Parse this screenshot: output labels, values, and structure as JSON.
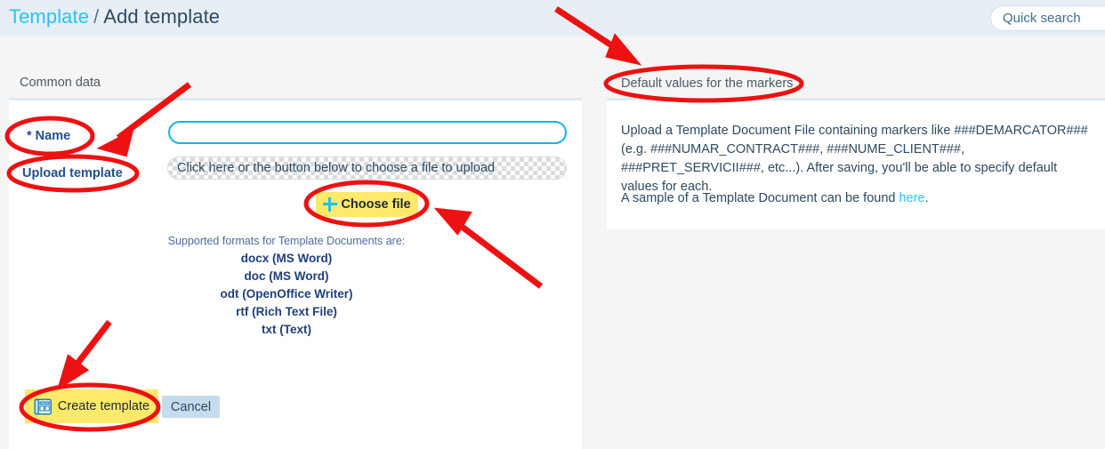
{
  "header": {
    "breadcrumb_root": "Template",
    "breadcrumb_separator": "/",
    "breadcrumb_current": "Add template",
    "quick_search_placeholder": "Quick search",
    "quick_search_value": ""
  },
  "left_panel": {
    "section_title": "Common data",
    "name_label": "* Name",
    "name_value": "",
    "name_placeholder": "",
    "upload_label": "Upload template",
    "dropzone_text": "Click here or the button below to choose a file to upload",
    "choose_file_label": "Choose file",
    "formats_heading": "Supported formats for Template Documents are:",
    "formats": [
      "docx (MS Word)",
      "doc (MS Word)",
      "odt (OpenOffice Writer)",
      "rtf (Rich Text File)",
      "txt (Text)"
    ],
    "create_label": "Create template",
    "cancel_label": "Cancel"
  },
  "right_panel": {
    "section_title": "Default values for the markers",
    "paragraph_1": "Upload a Template Document File containing markers like ###DEMARCATOR### (e.g. ###NUMAR_CONTRACT###, ###NUME_CLIENT###, ###PRET_SERVICII###, etc...). After saving, you'll be able to specify default values for each.",
    "paragraph_2_before_link": "A sample of a Template Document can be found ",
    "paragraph_2_link": "here",
    "paragraph_2_after_link": "."
  },
  "colors": {
    "header_bg": "#e7eef6",
    "page_bg": "#f5f5f5",
    "accent_cyan": "#29c3ef",
    "input_border": "#12b6e8",
    "label_blue": "#23518c",
    "highlight_yellow": "#ffe96a",
    "annotation_red": "#ee1111",
    "cancel_bg": "#c5dcec",
    "card_top_border": "#dfeaf3"
  },
  "annotations": {
    "ellipses": [
      "name-label-ellipse",
      "upload-label-ellipse",
      "choose-file-ellipse",
      "create-template-ellipse",
      "default-values-ellipse"
    ],
    "arrows": [
      "arrow-to-name-label",
      "arrow-to-default-values",
      "arrow-to-choose-file",
      "arrow-to-create-template"
    ]
  }
}
